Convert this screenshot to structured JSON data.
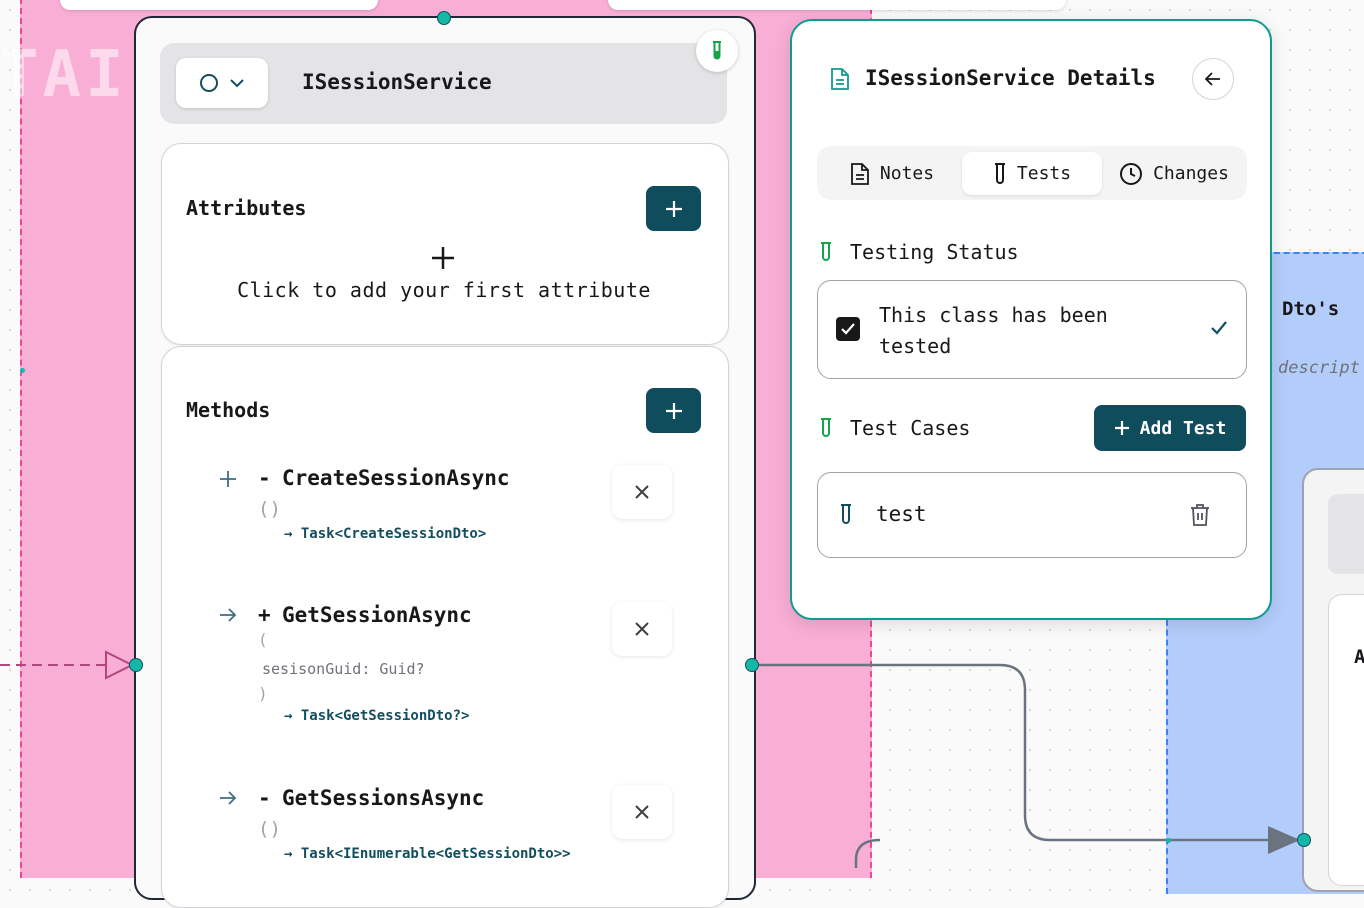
{
  "canvas": {
    "group_label": "TAI",
    "background_group_color": "#f9aed6",
    "secondary_group": {
      "title": "Dto's",
      "description": "descript",
      "node_letter": "A",
      "color": "#b3cdfb"
    }
  },
  "class_node": {
    "name": "ISessionService",
    "attributes": {
      "title": "Attributes",
      "empty_text": "Click to add your first attribute",
      "add_icon": "plus-icon"
    },
    "methods": {
      "title": "Methods",
      "items": [
        {
          "icon": "plus-icon",
          "visibility": "-",
          "name": "CreateSessionAsync",
          "params_open": "()",
          "param": "",
          "params_close": "",
          "return": "→ Task<CreateSessionDto>"
        },
        {
          "icon": "arrow-right-icon",
          "visibility": "+",
          "name": "GetSessionAsync",
          "params_open": "(",
          "param": "sesisonGuid: Guid?",
          "params_close": ")",
          "return": "→ Task<GetSessionDto?>"
        },
        {
          "icon": "arrow-right-icon",
          "visibility": "-",
          "name": "GetSessionsAsync",
          "params_open": "()",
          "param": "",
          "params_close": "",
          "return": "→ Task<IEnumerable<GetSessionDto>>"
        }
      ]
    }
  },
  "details_panel": {
    "title": "ISessionService Details",
    "tabs": [
      {
        "label": "Notes",
        "icon": "document-icon"
      },
      {
        "label": "Tests",
        "icon": "test-tube-icon",
        "active": true
      },
      {
        "label": "Changes",
        "icon": "clock-icon"
      }
    ],
    "testing_status": {
      "heading": "Testing Status",
      "checkbox_label": "This class has been tested",
      "checked": true
    },
    "test_cases": {
      "heading": "Test Cases",
      "add_button": "Add Test",
      "items": [
        {
          "name": "test"
        }
      ]
    }
  },
  "colors": {
    "accent": "#0f4c5c",
    "panel_border": "#0f9b8e",
    "handle": "#14b8a6"
  }
}
